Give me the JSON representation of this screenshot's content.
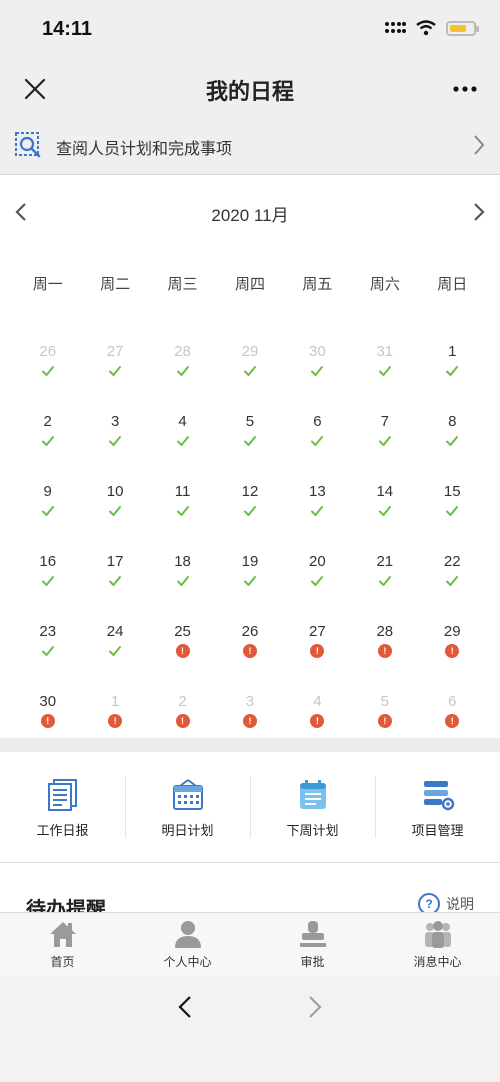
{
  "status": {
    "time": "14:11"
  },
  "nav": {
    "title": "我的日程"
  },
  "search": {
    "label": "查阅人员计划和完成事项"
  },
  "calendar": {
    "month_label": "2020 11月",
    "weekdays": [
      "周一",
      "周二",
      "周三",
      "周四",
      "周五",
      "周六",
      "周日"
    ],
    "days": [
      {
        "num": "26",
        "other": true,
        "mark": "check"
      },
      {
        "num": "27",
        "other": true,
        "mark": "check"
      },
      {
        "num": "28",
        "other": true,
        "mark": "check"
      },
      {
        "num": "29",
        "other": true,
        "mark": "check"
      },
      {
        "num": "30",
        "other": true,
        "mark": "check"
      },
      {
        "num": "31",
        "other": true,
        "mark": "check"
      },
      {
        "num": "1",
        "other": false,
        "mark": "check"
      },
      {
        "num": "2",
        "other": false,
        "mark": "check"
      },
      {
        "num": "3",
        "other": false,
        "mark": "check"
      },
      {
        "num": "4",
        "other": false,
        "mark": "check"
      },
      {
        "num": "5",
        "other": false,
        "mark": "check"
      },
      {
        "num": "6",
        "other": false,
        "mark": "check"
      },
      {
        "num": "7",
        "other": false,
        "mark": "check"
      },
      {
        "num": "8",
        "other": false,
        "mark": "check"
      },
      {
        "num": "9",
        "other": false,
        "mark": "check"
      },
      {
        "num": "10",
        "other": false,
        "mark": "check"
      },
      {
        "num": "11",
        "other": false,
        "mark": "check"
      },
      {
        "num": "12",
        "other": false,
        "mark": "check"
      },
      {
        "num": "13",
        "other": false,
        "mark": "check"
      },
      {
        "num": "14",
        "other": false,
        "mark": "check"
      },
      {
        "num": "15",
        "other": false,
        "mark": "check"
      },
      {
        "num": "16",
        "other": false,
        "mark": "check"
      },
      {
        "num": "17",
        "other": false,
        "mark": "check"
      },
      {
        "num": "18",
        "other": false,
        "mark": "check"
      },
      {
        "num": "19",
        "other": false,
        "mark": "check"
      },
      {
        "num": "20",
        "other": false,
        "mark": "check"
      },
      {
        "num": "21",
        "other": false,
        "mark": "check"
      },
      {
        "num": "22",
        "other": false,
        "mark": "check"
      },
      {
        "num": "23",
        "other": false,
        "mark": "check"
      },
      {
        "num": "24",
        "other": false,
        "mark": "check"
      },
      {
        "num": "25",
        "other": false,
        "mark": "alert"
      },
      {
        "num": "26",
        "other": false,
        "mark": "alert"
      },
      {
        "num": "27",
        "other": false,
        "mark": "alert"
      },
      {
        "num": "28",
        "other": false,
        "mark": "alert"
      },
      {
        "num": "29",
        "other": false,
        "mark": "alert"
      },
      {
        "num": "30",
        "other": false,
        "mark": "alert"
      },
      {
        "num": "1",
        "other": true,
        "mark": "alert"
      },
      {
        "num": "2",
        "other": true,
        "mark": "alert"
      },
      {
        "num": "3",
        "other": true,
        "mark": "alert"
      },
      {
        "num": "4",
        "other": true,
        "mark": "alert"
      },
      {
        "num": "5",
        "other": true,
        "mark": "alert"
      },
      {
        "num": "6",
        "other": true,
        "mark": "alert"
      }
    ],
    "check_color": "#6cbd45",
    "alert_color": "#e05a3a",
    "alert_symbol": "!"
  },
  "quick_actions": [
    {
      "label": "工作日报",
      "icon": "work-report-icon"
    },
    {
      "label": "明日计划",
      "icon": "tomorrow-plan-icon"
    },
    {
      "label": "下周计划",
      "icon": "next-week-plan-icon"
    },
    {
      "label": "项目管理",
      "icon": "project-management-icon"
    }
  ],
  "todo": {
    "title": "待办提醒",
    "help_label": "说明"
  },
  "tabs": [
    {
      "label": "首页",
      "icon": "home-icon"
    },
    {
      "label": "个人中心",
      "icon": "person-icon"
    },
    {
      "label": "审批",
      "icon": "stamp-icon"
    },
    {
      "label": "消息中心",
      "icon": "group-icon"
    }
  ]
}
